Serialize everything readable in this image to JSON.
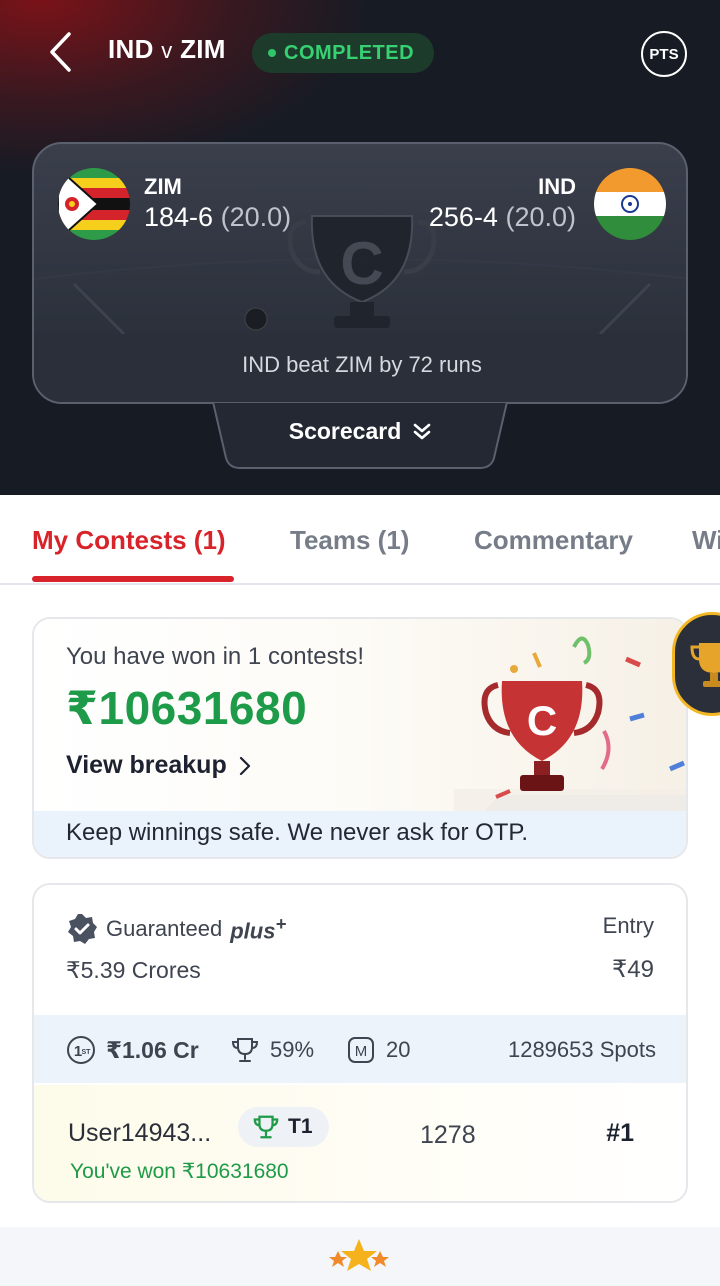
{
  "header": {
    "team_a": "IND",
    "vs": "v",
    "team_b": "ZIM",
    "status": "COMPLETED",
    "pts_label": "PTS"
  },
  "scorecard_summary": {
    "left_team": {
      "name": "ZIM",
      "score": "184-6",
      "overs": "(20.0)",
      "flag": "zimbabwe-flag"
    },
    "right_team": {
      "name": "IND",
      "score": "256-4",
      "overs": "(20.0)",
      "flag": "india-flag"
    },
    "result": "IND beat ZIM by 72 runs",
    "scorecard_label": "Scorecard"
  },
  "tabs": [
    {
      "label": "My Contests (1)",
      "active": true
    },
    {
      "label": "Teams (1)",
      "active": false
    },
    {
      "label": "Commentary",
      "active": false
    },
    {
      "label": "Wi",
      "active": false
    }
  ],
  "winnings": {
    "headline": "You have won in 1 contests!",
    "amount": "₹10631680",
    "view_breakup": "View breakup",
    "safety_note": "Keep winnings safe. We never ask for OTP."
  },
  "contest": {
    "type_label": "Guaranteed",
    "type_suffix": "plus",
    "type_sup": "+",
    "prize_pool": "₹5.39 Crores",
    "entry_label": "Entry",
    "entry_fee": "₹49",
    "first_prize": "₹1.06 Cr",
    "win_percent": "59%",
    "max_entries": "20",
    "spots": "1289653 Spots",
    "user": {
      "name": "User14943...",
      "team": "T1",
      "points": "1278",
      "rank": "#1",
      "won_text": "You've won ₹10631680"
    }
  },
  "colors": {
    "accent_red": "#d8232a",
    "win_green": "#1e9b49",
    "status_green": "#37d073",
    "header_bg": "#161b24"
  }
}
